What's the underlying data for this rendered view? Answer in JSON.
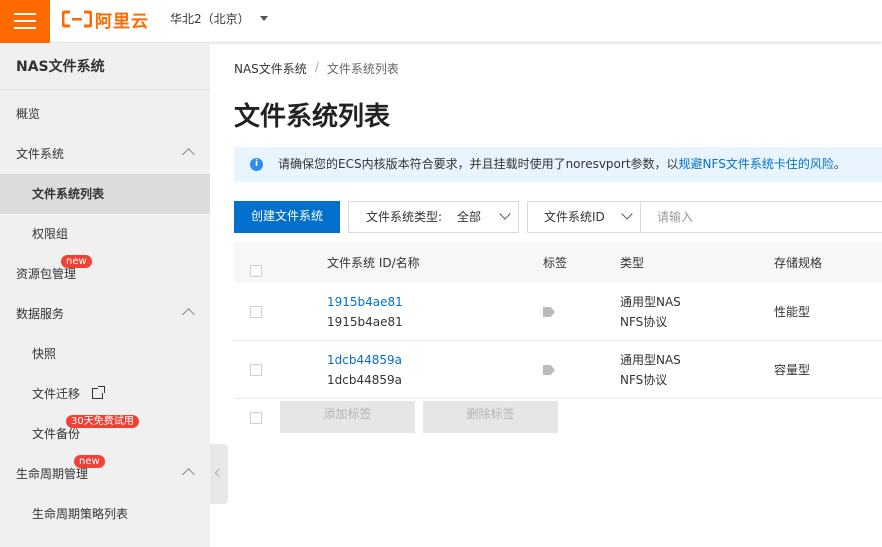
{
  "topbar": {
    "logo_text": "阿里云",
    "region": "华北2（北京）"
  },
  "sidebar": {
    "title": "NAS文件系统",
    "items": [
      {
        "label": "概览"
      },
      {
        "label": "文件系统"
      },
      {
        "label": "文件系统列表"
      },
      {
        "label": "权限组"
      },
      {
        "label": "资源包管理",
        "badge": "new"
      },
      {
        "label": "数据服务"
      },
      {
        "label": "快照"
      },
      {
        "label": "文件迁移"
      },
      {
        "label": "文件备份",
        "badge": "30天免费试用"
      },
      {
        "label": "生命周期管理",
        "badge": "new"
      },
      {
        "label": "生命周期策略列表"
      }
    ]
  },
  "breadcrumb": {
    "root": "NAS文件系统",
    "separator": "/",
    "current": "文件系统列表"
  },
  "page_title": "文件系统列表",
  "notice": {
    "text": "请确保您的ECS内核版本符合要求，并且挂载时使用了noresvport参数，以",
    "link": "规避NFS文件系统卡住的风险",
    "suffix": "。"
  },
  "toolbar": {
    "create_label": "创建文件系统",
    "type_filter_label": "文件系统类型:",
    "type_filter_value": "全部",
    "search_field": "文件系统ID",
    "search_placeholder": "请输入"
  },
  "table": {
    "columns": [
      "文件系统 ID/名称",
      "标签",
      "类型",
      "存储规格"
    ],
    "rows": [
      {
        "id": "1915b4ae81",
        "name": "1915b4ae81",
        "type_line1": "通用型NAS",
        "type_line2": "NFS协议",
        "spec": "性能型"
      },
      {
        "id": "1dcb44859a",
        "name": "1dcb44859a",
        "type_line1": "通用型NAS",
        "type_line2": "NFS协议",
        "spec": "容量型"
      }
    ]
  },
  "bulk_actions": {
    "add_tag": "添加标签",
    "remove_tag": "删除标签"
  },
  "colors": {
    "brand": "#ff6a00",
    "primary": "#0070cc",
    "badge": "#f04134"
  }
}
